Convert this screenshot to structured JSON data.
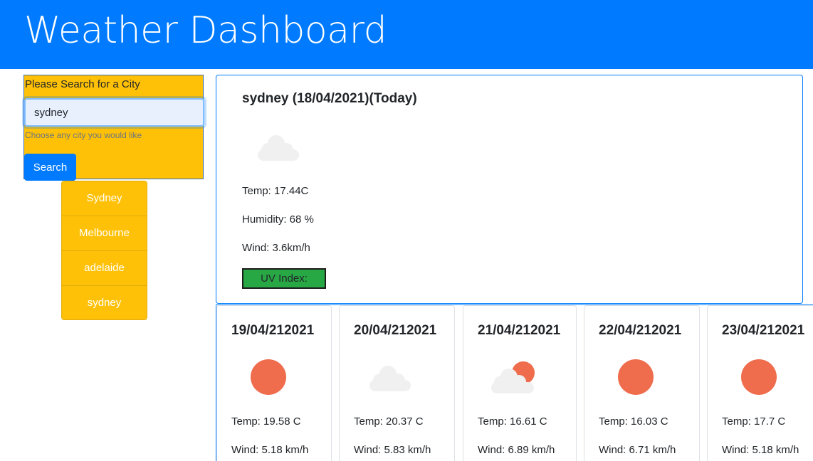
{
  "header": {
    "title": "Weather Dashboard"
  },
  "search": {
    "label": "Please Search for a City",
    "value": "sydney",
    "help": "Choose any city you would like",
    "button_label": "Search",
    "color": "#ffc107"
  },
  "history": [
    {
      "label": "Sydney"
    },
    {
      "label": "Melbourne"
    },
    {
      "label": "adelaide"
    },
    {
      "label": "sydney"
    }
  ],
  "current": {
    "title": "sydney (18/04/2021)(Today)",
    "icon": "cloud-icon",
    "temp": "Temp: 17.44C",
    "humidity": "Humidity: 68 %",
    "wind": "Wind: 3.6km/h",
    "uv_label": "UV Index:",
    "uv_color": "#28a745"
  },
  "forecast": [
    {
      "date": "19/04/212021",
      "icon": "sun-icon",
      "temp": "Temp: 19.58 C",
      "wind": "Wind: 5.18 km/h"
    },
    {
      "date": "20/04/212021",
      "icon": "cloud-icon",
      "temp": "Temp: 20.37 C",
      "wind": "Wind: 5.83 km/h"
    },
    {
      "date": "21/04/212021",
      "icon": "partly-cloudy-icon",
      "temp": "Temp: 16.61 C",
      "wind": "Wind: 6.89 km/h"
    },
    {
      "date": "22/04/212021",
      "icon": "sun-icon",
      "temp": "Temp: 16.03 C",
      "wind": "Wind: 6.71 km/h"
    },
    {
      "date": "23/04/212021",
      "icon": "sun-icon",
      "temp": "Temp: 17.7 C",
      "wind": "Wind: 5.18 km/h"
    }
  ],
  "colors": {
    "primary": "#007bff",
    "accent": "#ffc107",
    "sun": "#ef6c4d",
    "cloud": "#f0f0f0"
  }
}
